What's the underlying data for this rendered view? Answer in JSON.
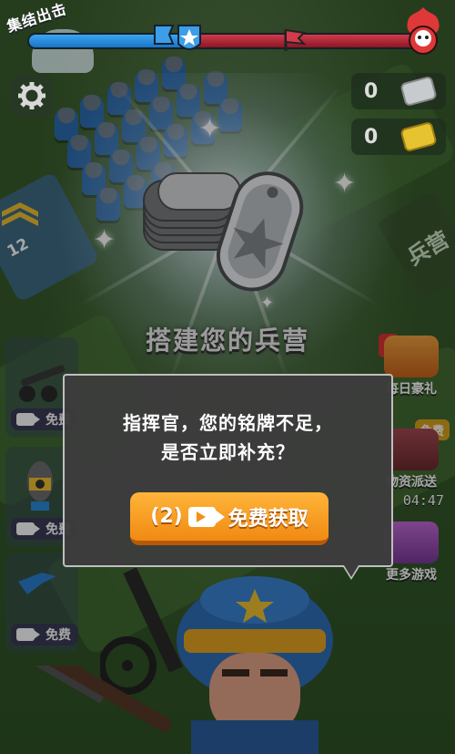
{
  "top": {
    "mission_label": "集结出击",
    "progress_blue_fraction": 0.43,
    "colors": {
      "ally": "#2a8bd8",
      "enemy": "#c52c3f"
    }
  },
  "resources": {
    "silver_medals": "0",
    "gold_medals": "0"
  },
  "scene": {
    "barracks_title": "搭建您的兵营",
    "side_label": "兵营",
    "rank_count": "12"
  },
  "left_units": [
    {
      "name": "artillery",
      "free_label": "免费"
    },
    {
      "name": "nuke",
      "free_label": "免费"
    },
    {
      "name": "plane",
      "free_label": "免费"
    }
  ],
  "right_menu": {
    "daily_gift": "每日豪礼",
    "supply_drop": "物资派送",
    "supply_free_tag": "免费",
    "supply_timer": "04:47",
    "more_games": "更多游戏",
    "alert_mark": "!"
  },
  "dialog": {
    "line1": "指挥官，您的铭牌不足，",
    "line2": "是否立即补充？",
    "button_count": "(2)",
    "button_label": "免费获取"
  }
}
